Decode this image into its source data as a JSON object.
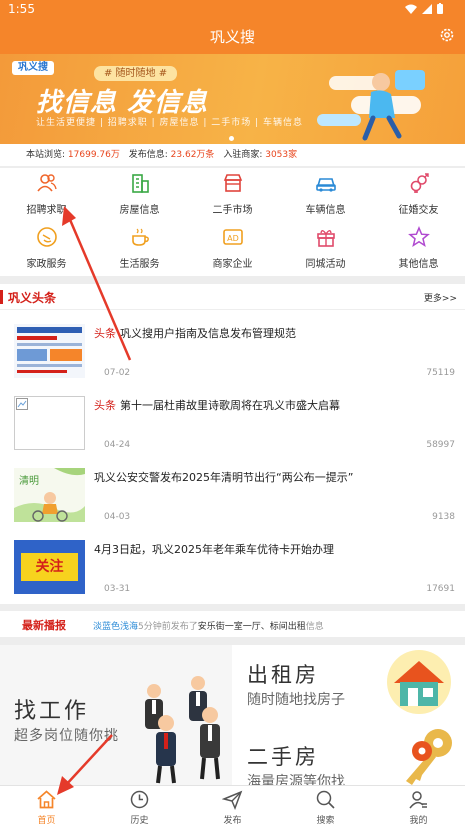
{
  "status_bar": {
    "time": "1:55"
  },
  "header": {
    "title": "巩义搜"
  },
  "banner": {
    "logo": "巩义搜",
    "tag": "# 随时随地 #",
    "slogan": "找信息 发信息",
    "tagline": "让生活更便捷 | 招聘求职 | 房屋信息 | 二手市场 | 车辆信息"
  },
  "stats": {
    "views_label": "本站浏览:",
    "views": "17699.76万",
    "posts_label": "发布信息:",
    "posts": "23.62万条",
    "shops_label": "入驻商家:",
    "shops": "3053家"
  },
  "categories": [
    {
      "label": "招聘求职",
      "icon": "people-icon",
      "color": "#f0652a"
    },
    {
      "label": "房屋信息",
      "icon": "building-icon",
      "color": "#3aa845"
    },
    {
      "label": "二手市场",
      "icon": "store-icon",
      "color": "#e0443c"
    },
    {
      "label": "车辆信息",
      "icon": "car-icon",
      "color": "#2a8ad6"
    },
    {
      "label": "征婚交友",
      "icon": "gender-icon",
      "color": "#e04a6a"
    },
    {
      "label": "家政服务",
      "icon": "broom-icon",
      "color": "#f0a020"
    },
    {
      "label": "生活服务",
      "icon": "coffee-icon",
      "color": "#f0a020"
    },
    {
      "label": "商家企业",
      "icon": "ad-icon",
      "color": "#f0a020"
    },
    {
      "label": "同城活动",
      "icon": "gift-icon",
      "color": "#e04a6a"
    },
    {
      "label": "其他信息",
      "icon": "star-icon",
      "color": "#b04ad0"
    }
  ],
  "news": {
    "section_title": "巩义头条",
    "more": "更多>>",
    "items": [
      {
        "hot": "头条",
        "title": "巩义搜用户指南及信息发布管理规范",
        "date": "07-02",
        "views": "75119"
      },
      {
        "hot": "头条",
        "title": "第十一届杜甫故里诗歌周将在巩义市盛大启幕",
        "date": "04-24",
        "views": "58997"
      },
      {
        "hot": "",
        "title": "巩义公安交警发布2025年清明节出行“两公布一提示”",
        "date": "04-03",
        "views": "9138"
      },
      {
        "hot": "",
        "title": "4月3日起，巩义2025年老年乘车优待卡开始办理",
        "date": "03-31",
        "views": "17691"
      }
    ],
    "thumb_text_4": "关注"
  },
  "live": {
    "label": "最新播报",
    "user": "淡蓝色浅海",
    "time": "5分钟前发布了",
    "place": "安乐街一室一厅、标间出租",
    "suffix": "信息"
  },
  "promo": {
    "jobs_title": "找工作",
    "jobs_sub": "超多岗位随你挑",
    "rent_title": "出租房",
    "rent_sub": "随时随地找房子",
    "used_title": "二手房",
    "used_sub": "海量房源等你找"
  },
  "tabs": [
    {
      "label": "首页",
      "icon": "home-icon",
      "active": true
    },
    {
      "label": "历史",
      "icon": "clock-icon"
    },
    {
      "label": "发布",
      "icon": "send-icon"
    },
    {
      "label": "搜索",
      "icon": "search-icon"
    },
    {
      "label": "我的",
      "icon": "profile-icon"
    }
  ],
  "colors": {
    "primary": "#f5852a",
    "red": "#d4211a",
    "link": "#2a8ad6",
    "annotation": "#e53a2a"
  }
}
